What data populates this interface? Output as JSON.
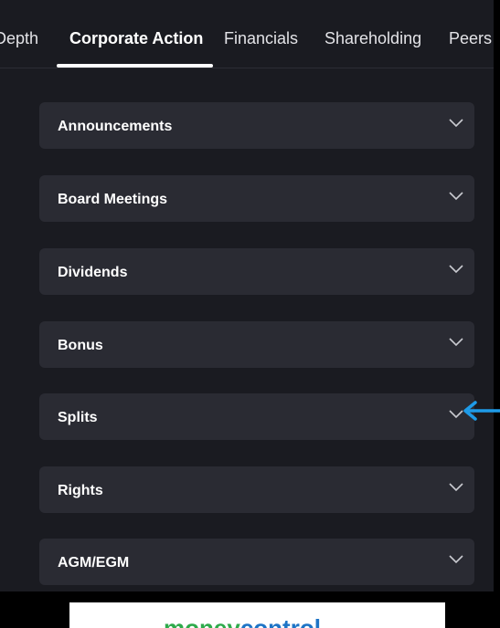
{
  "tabs": [
    {
      "label": "Depth",
      "active": false
    },
    {
      "label": "Corporate Action",
      "active": true
    },
    {
      "label": "Financials",
      "active": false
    },
    {
      "label": "Shareholding",
      "active": false
    },
    {
      "label": "Peers",
      "active": false
    }
  ],
  "sections": [
    {
      "label": "Announcements",
      "icon": "chevron-down-icon"
    },
    {
      "label": "Board Meetings",
      "icon": "chevron-down-icon"
    },
    {
      "label": "Dividends",
      "icon": "chevron-down-icon"
    },
    {
      "label": "Bonus",
      "icon": "chevron-down-icon"
    },
    {
      "label": "Splits",
      "icon": "chevron-down-icon"
    },
    {
      "label": "Rights",
      "icon": "chevron-down-icon"
    },
    {
      "label": "AGM/EGM",
      "icon": "chevron-down-icon"
    }
  ],
  "annotation": {
    "icon": "arrow-left-icon",
    "color": "#1e9be8"
  },
  "ad": {
    "logo_part1": "money",
    "logo_part2": "control"
  },
  "colors": {
    "background": "#1a1b21",
    "card": "#2a2b33",
    "text": "#ffffff",
    "brand_green": "#2eaa4b",
    "brand_blue": "#1e74c6"
  }
}
